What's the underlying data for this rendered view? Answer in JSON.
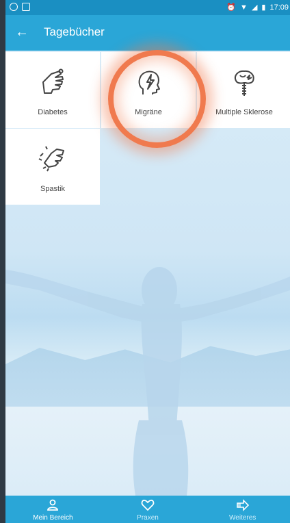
{
  "status_bar": {
    "time": "17:09"
  },
  "app_bar": {
    "title": "Tagebücher"
  },
  "tiles": [
    {
      "label": "Diabetes",
      "icon": "hand-stop-icon"
    },
    {
      "label": "Migräne",
      "icon": "head-lightning-icon"
    },
    {
      "label": "Multiple Sklerose",
      "icon": "brain-spine-icon"
    },
    {
      "label": "Spastik",
      "icon": "hand-tremor-icon"
    }
  ],
  "bottom_nav": [
    {
      "label": "Mein Bereich",
      "icon": "person-icon",
      "active": true
    },
    {
      "label": "Praxen",
      "icon": "heart-icon",
      "active": false
    },
    {
      "label": "Weiteres",
      "icon": "arrow-right-icon",
      "active": false
    }
  ],
  "colors": {
    "primary": "#2aa6d7",
    "status_bar": "#1a8fc2",
    "highlight": "#f07a4e"
  }
}
